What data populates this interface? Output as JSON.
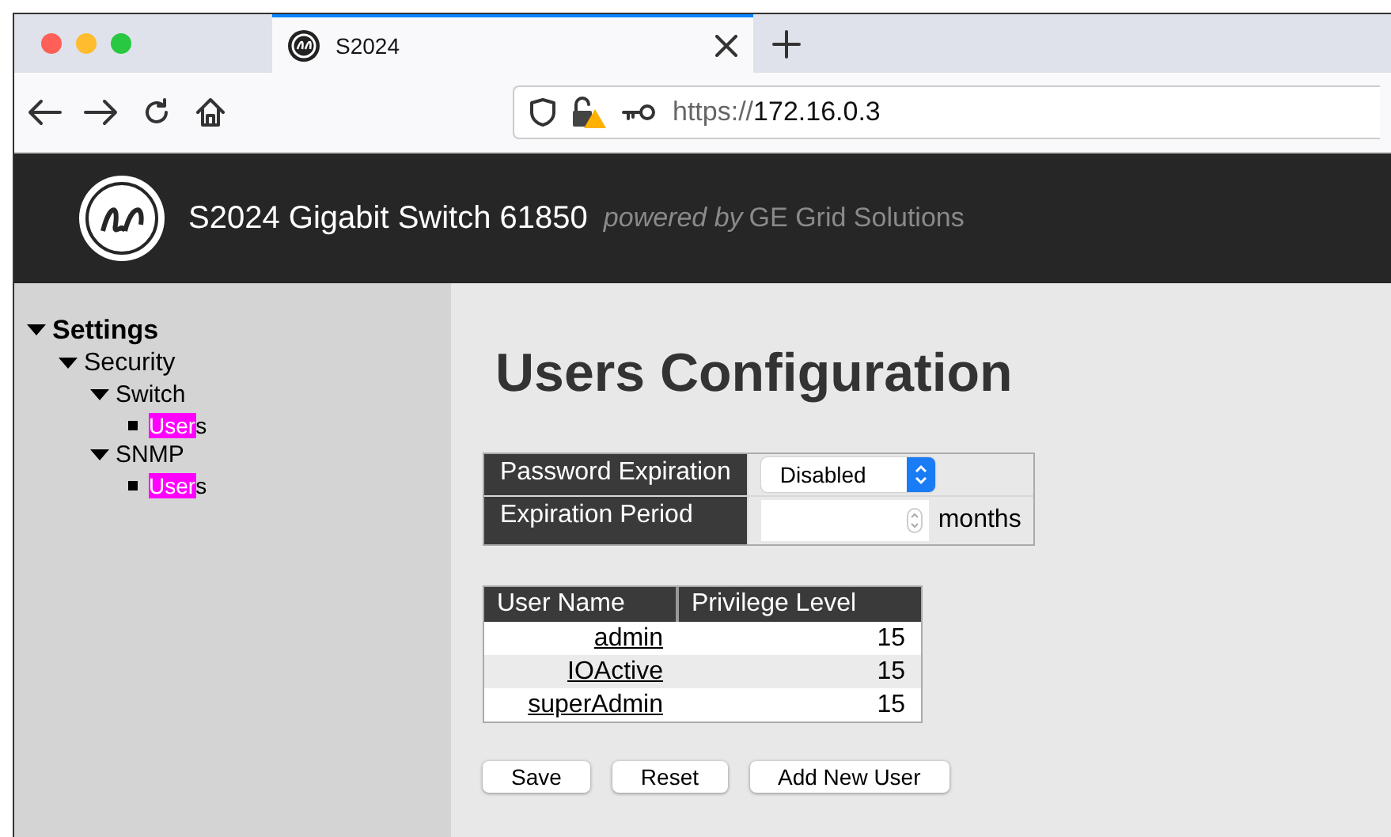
{
  "browser": {
    "tab": {
      "title": "S2024",
      "selected": true
    },
    "url": {
      "scheme": "https://",
      "host": "172.16.0.3"
    }
  },
  "header": {
    "title": "S2024 Gigabit Switch 61850",
    "tagline": "powered by",
    "vendor": "GE Grid Solutions"
  },
  "sidebar": {
    "tree": [
      {
        "label": "Settings",
        "kind": "folder",
        "expanded": true,
        "children": [
          {
            "label": "Security",
            "kind": "folder",
            "expanded": true,
            "children": [
              {
                "label": "Switch",
                "kind": "folder",
                "expanded": true,
                "children": [
                  {
                    "kind": "leaf",
                    "highlight": "User",
                    "rest": "s"
                  }
                ]
              },
              {
                "label": "SNMP",
                "kind": "folder",
                "expanded": true,
                "children": [
                  {
                    "kind": "leaf",
                    "highlight": "User",
                    "rest": "s"
                  }
                ]
              }
            ]
          }
        ]
      }
    ]
  },
  "page": {
    "title": "Users Configuration",
    "settings": [
      {
        "label": "Password Expiration",
        "kind": "select",
        "value": "Disabled"
      },
      {
        "label": "Expiration Period",
        "kind": "number",
        "unit": "months"
      }
    ],
    "users_table": {
      "columns": [
        "User Name",
        "Privilege Level"
      ],
      "rows": [
        {
          "user": "admin",
          "level": "15"
        },
        {
          "user": "IOActive",
          "level": "15"
        },
        {
          "user": "superAdmin",
          "level": "15"
        }
      ]
    },
    "buttons": [
      "Save",
      "Reset",
      "Add New User"
    ]
  }
}
